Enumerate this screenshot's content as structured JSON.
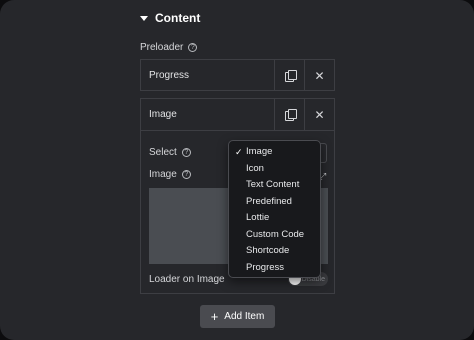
{
  "section": {
    "title": "Content"
  },
  "preloader": {
    "label": "Preloader"
  },
  "items": [
    {
      "title": "Progress"
    },
    {
      "title": "Image"
    }
  ],
  "fields": {
    "select_label": "Select",
    "image_label": "Image",
    "loader_on_image_label": "Loader on Image",
    "toggle_text": "Disable"
  },
  "dropdown": {
    "options": [
      "Image",
      "Icon",
      "Text Content",
      "Predefined",
      "Lottie",
      "Custom Code",
      "Shortcode",
      "Progress"
    ],
    "selected": "Image"
  },
  "add_item": {
    "label": "Add Item"
  },
  "icons": {
    "caret": "caret-down-icon",
    "help": "help-circle-icon",
    "copy": "copy-icon",
    "close": "close-icon",
    "expand": "expand-icon",
    "plus": "plus-icon"
  }
}
